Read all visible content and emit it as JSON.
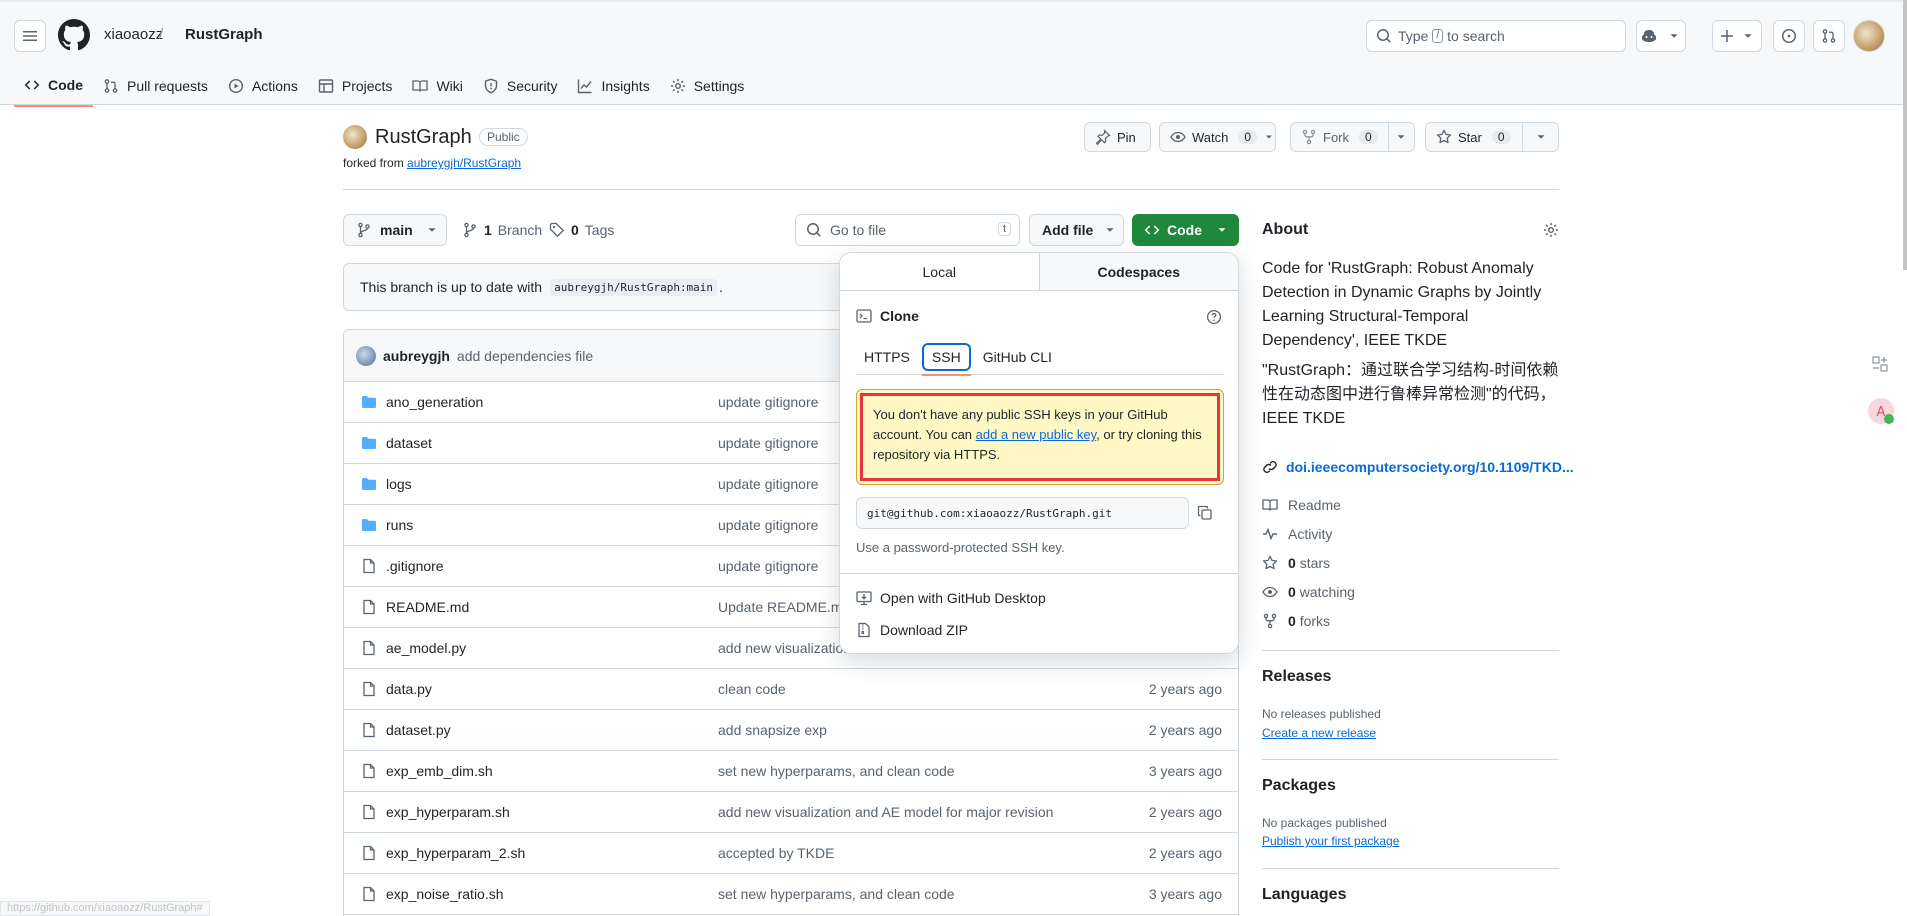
{
  "header": {
    "owner": "xiaoaozz",
    "slash": "/",
    "repo": "RustGraph",
    "search_pre": "Type",
    "search_key": "/",
    "search_post": "to search"
  },
  "nav_tabs": [
    {
      "label": "Code"
    },
    {
      "label": "Pull requests"
    },
    {
      "label": "Actions"
    },
    {
      "label": "Projects"
    },
    {
      "label": "Wiki"
    },
    {
      "label": "Security"
    },
    {
      "label": "Insights"
    },
    {
      "label": "Settings"
    }
  ],
  "repo": {
    "name": "RustGraph",
    "visibility": "Public",
    "forked_from_label": "forked from",
    "forked_from": "aubreygjh/RustGraph",
    "pin_label": "Pin",
    "watch_label": "Watch",
    "watch_count": "0",
    "fork_label": "Fork",
    "fork_count": "0",
    "star_label": "Star",
    "star_count": "0"
  },
  "toolbar": {
    "branch": "main",
    "branch_count": "1",
    "branch_label": "Branch",
    "tag_count": "0",
    "tag_label": "Tags",
    "goto_placeholder": "Go to file",
    "goto_key": "t",
    "add_file": "Add file",
    "code": "Code"
  },
  "uptodate": {
    "text": "This branch is up to date with",
    "ref": "aubreygjh/RustGraph:main",
    "period": "."
  },
  "latest_commit": {
    "author": "aubreygjh",
    "message": "add dependencies file"
  },
  "files": [
    {
      "name": "ano_generation",
      "type": "folder",
      "message": "update gitignore",
      "date": ""
    },
    {
      "name": "dataset",
      "type": "folder",
      "message": "update gitignore",
      "date": ""
    },
    {
      "name": "logs",
      "type": "folder",
      "message": "update gitignore",
      "date": ""
    },
    {
      "name": "runs",
      "type": "folder",
      "message": "update gitignore",
      "date": ""
    },
    {
      "name": ".gitignore",
      "type": "file",
      "message": "update gitignore",
      "date": ""
    },
    {
      "name": "README.md",
      "type": "file",
      "message": "Update README.md",
      "date": ""
    },
    {
      "name": "ae_model.py",
      "type": "file",
      "message": "add new visualization",
      "date": ""
    },
    {
      "name": "data.py",
      "type": "file",
      "message": "clean code",
      "date": "2 years ago"
    },
    {
      "name": "dataset.py",
      "type": "file",
      "message": "add snapsize exp",
      "date": "2 years ago"
    },
    {
      "name": "exp_emb_dim.sh",
      "type": "file",
      "message": "set new hyperparams, and clean code",
      "date": "3 years ago"
    },
    {
      "name": "exp_hyperparam.sh",
      "type": "file",
      "message": "add new visualization and AE model for major revision",
      "date": "2 years ago"
    },
    {
      "name": "exp_hyperparam_2.sh",
      "type": "file",
      "message": "accepted by TKDE",
      "date": "2 years ago"
    },
    {
      "name": "exp_noise_ratio.sh",
      "type": "file",
      "message": "set new hyperparams, and clean code",
      "date": "3 years ago"
    }
  ],
  "clone": {
    "tab_local": "Local",
    "tab_codespaces": "Codespaces",
    "title": "Clone",
    "protocols": [
      "HTTPS",
      "SSH",
      "GitHub CLI"
    ],
    "warning_pre": "You don't have any public SSH keys in your GitHub account. You can ",
    "warning_link": "add a new public key",
    "warning_post": ", or try cloning this repository via HTTPS.",
    "url": "git@github.com:xiaoaozz/RustGraph.git",
    "hint": "Use a password-protected SSH key.",
    "open_desktop": "Open with GitHub Desktop",
    "download_zip": "Download ZIP"
  },
  "about": {
    "title": "About",
    "description": "Code for 'RustGraph: Robust Anomaly Detection in Dynamic Graphs by Jointly Learning Structural-Temporal Dependency', IEEE TKDE",
    "description_cn": "\"RustGraph：通过联合学习结构-时间依赖性在动态图中进行鲁棒异常检测\"的代码，IEEE TKDE",
    "link": "doi.ieeecomputersociety.org/10.1109/TKD...",
    "readme": "Readme",
    "activity": "Activity",
    "stars_count": "0",
    "stars_label": "stars",
    "watching_count": "0",
    "watching_label": "watching",
    "forks_count": "0",
    "forks_label": "forks"
  },
  "releases": {
    "title": "Releases",
    "none": "No releases published",
    "create": "Create a new release"
  },
  "packages": {
    "title": "Packages",
    "none": "No packages published",
    "publish": "Publish your first package"
  },
  "languages": {
    "title": "Languages"
  },
  "statusbar": {
    "url": "https://github.com/xiaoaozz/RustGraph#"
  },
  "colors": {
    "accent": "#0969da",
    "code_button": "#1f883d",
    "tab_underline": "#fd8c73",
    "warning_bg": "#fff8c5",
    "warning_border": "#e5343a"
  }
}
